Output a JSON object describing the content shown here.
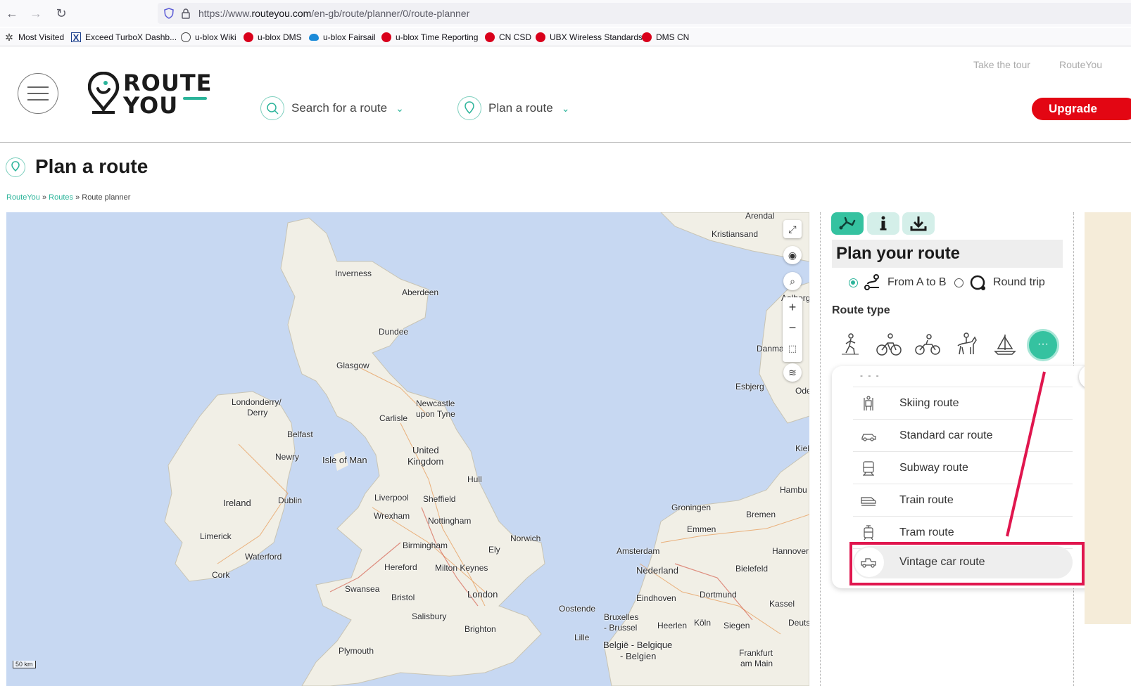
{
  "browser": {
    "url_prefix": "https://www.",
    "url_host": "routeyou.com",
    "url_path": "/en-gb/route/planner/0/route-planner",
    "bookmarks": [
      {
        "label": "Most Visited",
        "icon": "gear-icon"
      },
      {
        "label": "Exceed TurboX Dashb...",
        "icon": "x-icon"
      },
      {
        "label": "u-blox Wiki",
        "icon": "globe-icon"
      },
      {
        "label": "u-blox DMS",
        "icon": "ublox-icon"
      },
      {
        "label": "u-blox Fairsail",
        "icon": "cloud-icon"
      },
      {
        "label": "u-blox Time Reporting",
        "icon": "ublox-icon"
      },
      {
        "label": "CN CSD",
        "icon": "ublox-icon"
      },
      {
        "label": "UBX Wireless Standards",
        "icon": "ublox-icon"
      },
      {
        "label": "DMS CN",
        "icon": "ublox-icon"
      }
    ]
  },
  "site": {
    "logo_line1": "ROUTE",
    "logo_line2": "YOU",
    "nav_search": "Search for a route",
    "nav_plan": "Plan a route",
    "take_tour": "Take the tour",
    "routeyou_link": "RouteYou",
    "upgrade": "Upgrade",
    "accent": "#2bb49a",
    "upgrade_color": "#e30613"
  },
  "page": {
    "title": "Plan a route",
    "breadcrumb": {
      "home": "RouteYou",
      "routes": "Routes",
      "sep": " » ",
      "current": "Route planner"
    }
  },
  "map": {
    "scale": "50 km",
    "labels": {
      "arendal": "Arendal",
      "kristiansand": "Kristiansand",
      "inverness": "Inverness",
      "aberdeen": "Aberdeen",
      "dundee": "Dundee",
      "glasgow": "Glasgow",
      "aalborg": "Aalborg",
      "danmark": "Danma",
      "londonderry": "Londonderry/",
      "derry": "Derry",
      "newcastle": "Newcastle",
      "upon_tyne": "upon Tyne",
      "carlisle": "Carlisle",
      "esbjerg": "Esbjerg",
      "ode": "Ode",
      "belfast": "Belfast",
      "newry": "Newry",
      "isle_of_man": "Isle of Man",
      "united": "United",
      "kingdom": "Kingdom",
      "kiel": "Kiel",
      "hull": "Hull",
      "hambu": "Hambu",
      "ireland": "Ireland",
      "dublin": "Dublin",
      "liverpool": "Liverpool",
      "sheffield": "Sheffield",
      "groningen": "Groningen",
      "wrexham": "Wrexham",
      "nottingham": "Nottingham",
      "bremen": "Bremen",
      "emmen": "Emmen",
      "limerick": "Limerick",
      "birmingham": "Birmingham",
      "norwich": "Norwich",
      "ely": "Ely",
      "amsterdam": "Amsterdam",
      "hannover": "Hannover",
      "waterford": "Waterford",
      "hereford": "Hereford",
      "milton_keynes": "Milton Keynes",
      "nederland": "Nederland",
      "bielefeld": "Bielefeld",
      "cork": "Cork",
      "swansea": "Swansea",
      "london": "London",
      "eindhoven": "Eindhoven",
      "dortmund": "Dortmund",
      "bristol": "Bristol",
      "oostende": "Oostende",
      "kassel": "Kassel",
      "salisbury": "Salisbury",
      "bruxelles": "Bruxelles",
      "brussel": "- Brussel",
      "heerlen": "Heerlen",
      "koln": "Köln",
      "siegen": "Siegen",
      "deuts": "Deuts",
      "brighton": "Brighton",
      "lille": "Lille",
      "belgie": "België - Belgique",
      "belgien": "- Belgien",
      "plymouth": "Plymouth",
      "frankfurt": "Frankfurt",
      "am_main": "am Main"
    }
  },
  "panel": {
    "title": "Plan your route",
    "from_a_to_b": "From A to B",
    "round_trip": "Round trip",
    "route_type": "Route type",
    "more_label": "···",
    "dropdown": {
      "top_marker": "- - -",
      "items": [
        {
          "label": "Skiing route",
          "icon": "skiing-icon"
        },
        {
          "label": "Standard car route",
          "icon": "car-icon"
        },
        {
          "label": "Subway route",
          "icon": "subway-icon"
        },
        {
          "label": "Train route",
          "icon": "train-icon"
        },
        {
          "label": "Tram route",
          "icon": "tram-icon"
        },
        {
          "label": "Vintage car route",
          "icon": "vintage-car-icon",
          "selected": true
        }
      ],
      "close": "✕"
    },
    "highlight_color": "#e0164e"
  }
}
